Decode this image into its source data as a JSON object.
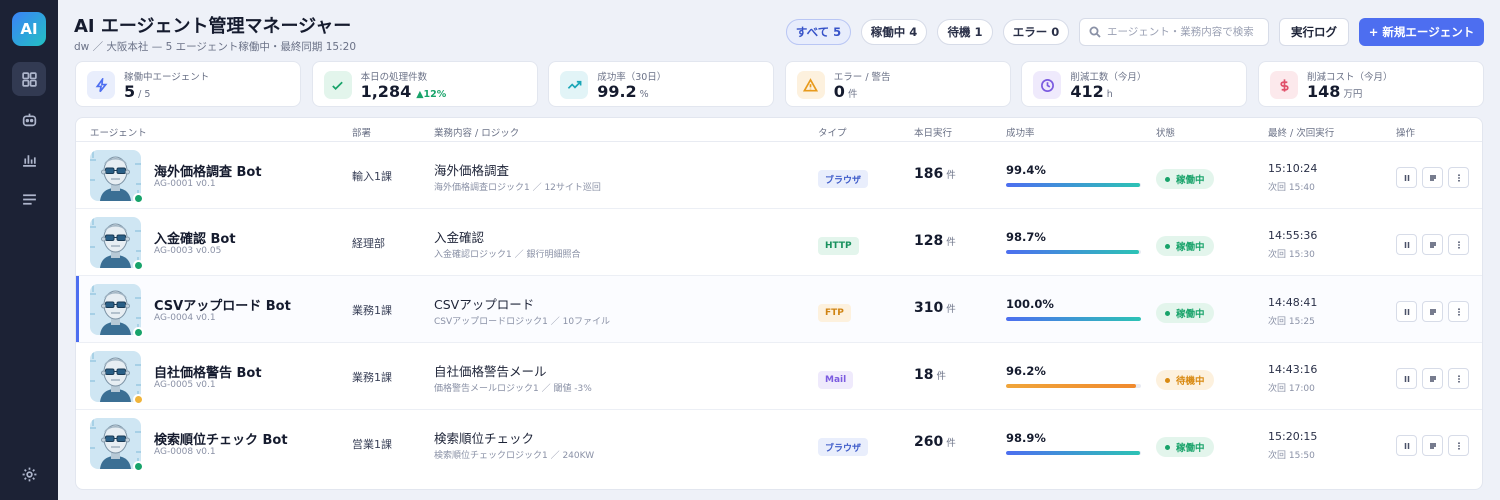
{
  "app": {
    "logo": "AI",
    "title": "AI エージェント管理マネージャー",
    "subtitle": "dw ／ 大阪本社 — 5 エージェント稼働中・最終同期 15:20"
  },
  "sidebar": {
    "items": [
      {
        "icon": "dashboard-grid-icon",
        "active": true
      },
      {
        "icon": "robot-icon",
        "active": false
      },
      {
        "icon": "bar-chart-icon",
        "active": false
      },
      {
        "icon": "list-lines-icon",
        "active": false
      },
      {
        "icon": "gear-icon",
        "active": false
      }
    ]
  },
  "filters": [
    {
      "label": "すべて 5",
      "active": true
    },
    {
      "label": "稼働中 4",
      "active": false
    },
    {
      "label": "待機 1",
      "active": false
    },
    {
      "label": "エラー 0",
      "active": false
    }
  ],
  "search": {
    "placeholder": "エージェント・業務内容で検索",
    "value": ""
  },
  "toolbar": {
    "log_label": "実行ログ",
    "new_label": "+ 新規エージェント"
  },
  "kpis": [
    {
      "label": "稼働中エージェント",
      "value": "5",
      "unit": "/ 5",
      "icon": "lightning-icon",
      "color": "#4d6ef0",
      "bg": "#e9eefc"
    },
    {
      "label": "本日の処理件数",
      "value": "1,284",
      "delta": "▲12%",
      "icon": "check-icon",
      "color": "#18a36a",
      "bg": "#e3f5ec"
    },
    {
      "label": "成功率（30日）",
      "value": "99.2",
      "unit": "%",
      "icon": "trend-icon",
      "color": "#1aa6b7",
      "bg": "#e2f4f7"
    },
    {
      "label": "エラー / 警告",
      "value": "0",
      "unit": "件",
      "icon": "warning-icon",
      "color": "#e89a1c",
      "bg": "#fdf1de"
    },
    {
      "label": "削減工数（今月）",
      "value": "412",
      "unit": "h",
      "icon": "clock-icon",
      "color": "#7b5be0",
      "bg": "#efeafc"
    },
    {
      "label": "削減コスト（今月）",
      "value": "148",
      "unit": "万円",
      "icon": "dollar-icon",
      "color": "#e0506a",
      "bg": "#fce9ec"
    }
  ],
  "table": {
    "headers": [
      "エージェント",
      "部署",
      "業務内容 / ロジック",
      "タイプ",
      "本日実行",
      "成功率",
      "状態",
      "最終 / 次回実行",
      "操作"
    ],
    "rows": [
      {
        "name": "海外価格調査 Bot",
        "id": "AG-0001 v0.1",
        "dept": "輸入1課",
        "task": "海外価格調査",
        "logic": "海外価格調査ロジック1 ／ 12サイト巡回",
        "type": "ブラウザ",
        "type_color": "#3f5cc9",
        "type_bg": "#e9eefc",
        "runs": "186",
        "runs_unit": "件",
        "rate": "99.4%",
        "rate_value": 0.994,
        "bar": [
          "#4d6ef0",
          "#2cc3b5"
        ],
        "state": "稼働中",
        "state_color": "#18a36a",
        "state_bg": "#e3f5ec",
        "dot": "#18a36a",
        "last": "15:10:24",
        "next": "次回 15:40",
        "selected": false
      },
      {
        "name": "入金確認 Bot",
        "id": "AG-0003 v0.05",
        "dept": "経理部",
        "task": "入金確認",
        "logic": "入金確認ロジック1 ／ 銀行明細照合",
        "type": "HTTP",
        "type_color": "#18915e",
        "type_bg": "#e3f5ec",
        "runs": "128",
        "runs_unit": "件",
        "rate": "98.7%",
        "rate_value": 0.987,
        "bar": [
          "#4d6ef0",
          "#2cc3b5"
        ],
        "state": "稼働中",
        "state_color": "#18a36a",
        "state_bg": "#e3f5ec",
        "dot": "#18a36a",
        "last": "14:55:36",
        "next": "次回 15:30",
        "selected": false
      },
      {
        "name": "CSVアップロード Bot",
        "id": "AG-0004 v0.1",
        "dept": "業務1課",
        "task": "CSVアップロード",
        "logic": "CSVアップロードロジック1 ／ 10ファイル",
        "type": "FTP",
        "type_color": "#d08414",
        "type_bg": "#fdf1de",
        "runs": "310",
        "runs_unit": "件",
        "rate": "100.0%",
        "rate_value": 1.0,
        "bar": [
          "#4d6ef0",
          "#2cc3b5"
        ],
        "state": "稼働中",
        "state_color": "#18a36a",
        "state_bg": "#e3f5ec",
        "dot": "#18a36a",
        "last": "14:48:41",
        "next": "次回 15:25",
        "selected": true
      },
      {
        "name": "自社価格警告 Bot",
        "id": "AG-0005 v0.1",
        "dept": "業務1課",
        "task": "自社価格警告メール",
        "logic": "価格警告メールロジック1 ／ 閾値 -3%",
        "type": "Mail",
        "type_color": "#7b5be0",
        "type_bg": "#efeafc",
        "runs": "18",
        "runs_unit": "件",
        "rate": "96.2%",
        "rate_value": 0.962,
        "bar": [
          "#f0a53a",
          "#f08a2e"
        ],
        "state": "待機中",
        "state_color": "#d98a12",
        "state_bg": "#fdf1de",
        "dot": "#f0b43a",
        "last": "14:43:16",
        "next": "次回 17:00",
        "selected": false
      },
      {
        "name": "検索順位チェック Bot",
        "id": "AG-0008 v0.1",
        "dept": "営業1課",
        "task": "検索順位チェック",
        "logic": "検索順位チェックロジック1 ／ 240KW",
        "type": "ブラウザ",
        "type_color": "#3f5cc9",
        "type_bg": "#e9eefc",
        "runs": "260",
        "runs_unit": "件",
        "rate": "98.9%",
        "rate_value": 0.989,
        "bar": [
          "#4d6ef0",
          "#2cc3b5"
        ],
        "state": "稼働中",
        "state_color": "#18a36a",
        "state_bg": "#e3f5ec",
        "dot": "#18a36a",
        "last": "15:20:15",
        "next": "次回 15:50",
        "selected": false
      }
    ]
  }
}
